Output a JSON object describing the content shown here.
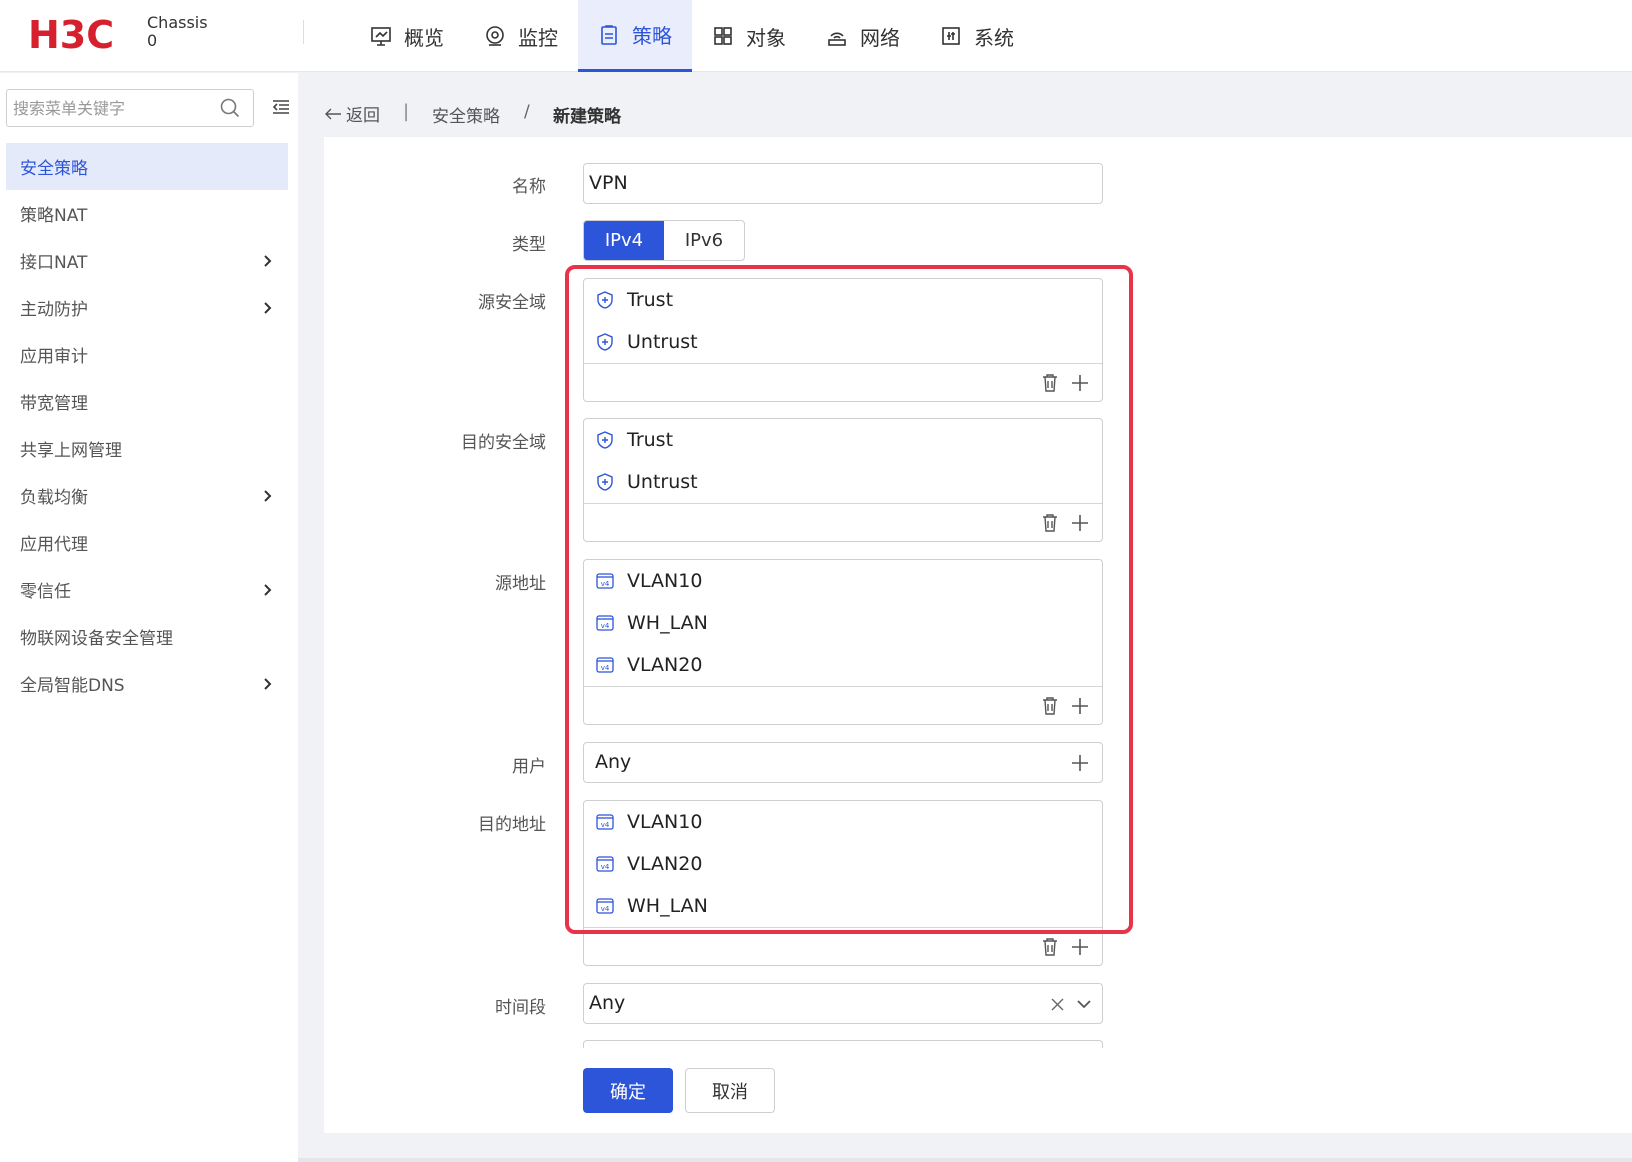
{
  "header": {
    "logo_text": "H3C",
    "chassis_label": "Chassis",
    "chassis_value": "0",
    "nav": [
      {
        "label": "概览",
        "icon": "overview-icon"
      },
      {
        "label": "监控",
        "icon": "monitor-icon"
      },
      {
        "label": "策略",
        "icon": "policy-icon",
        "active": true
      },
      {
        "label": "对象",
        "icon": "object-icon"
      },
      {
        "label": "网络",
        "icon": "network-icon"
      },
      {
        "label": "系统",
        "icon": "system-icon"
      }
    ]
  },
  "sidebar": {
    "search_placeholder": "搜索菜单关键字",
    "items": [
      {
        "label": "安全策略",
        "active": true,
        "expandable": false
      },
      {
        "label": "策略NAT",
        "expandable": false
      },
      {
        "label": "接口NAT",
        "expandable": true
      },
      {
        "label": "主动防护",
        "expandable": true
      },
      {
        "label": "应用审计",
        "expandable": false
      },
      {
        "label": "带宽管理",
        "expandable": false
      },
      {
        "label": "共享上网管理",
        "expandable": false
      },
      {
        "label": "负载均衡",
        "expandable": true
      },
      {
        "label": "应用代理",
        "expandable": false
      },
      {
        "label": "零信任",
        "expandable": true
      },
      {
        "label": "物联网设备安全管理",
        "expandable": false
      },
      {
        "label": "全局智能DNS",
        "expandable": true
      }
    ]
  },
  "breadcrumb": {
    "back_label": "返回",
    "separator_bar": "|",
    "section": "安全策略",
    "separator": "/",
    "current": "新建策略"
  },
  "form": {
    "name": {
      "label": "名称",
      "value": "VPN"
    },
    "type": {
      "label": "类型",
      "options": [
        "IPv4",
        "IPv6"
      ],
      "selected": "IPv4"
    },
    "src_zone": {
      "label": "源安全域",
      "items": [
        "Trust",
        "Untrust"
      ]
    },
    "dst_zone": {
      "label": "目的安全域",
      "items": [
        "Trust",
        "Untrust"
      ]
    },
    "src_addr": {
      "label": "源地址",
      "items": [
        "VLAN10",
        "WH_LAN",
        "VLAN20"
      ]
    },
    "user": {
      "label": "用户",
      "value": "Any"
    },
    "dst_addr": {
      "label": "目的地址",
      "items": [
        "VLAN10",
        "VLAN20",
        "WH_LAN"
      ]
    },
    "time_range": {
      "label": "时间段",
      "value": "Any"
    },
    "ok_label": "确定",
    "cancel_label": "取消"
  },
  "colors": {
    "accent": "#2d55d9",
    "highlight": "#e8334a",
    "brand": "#d6202d"
  }
}
